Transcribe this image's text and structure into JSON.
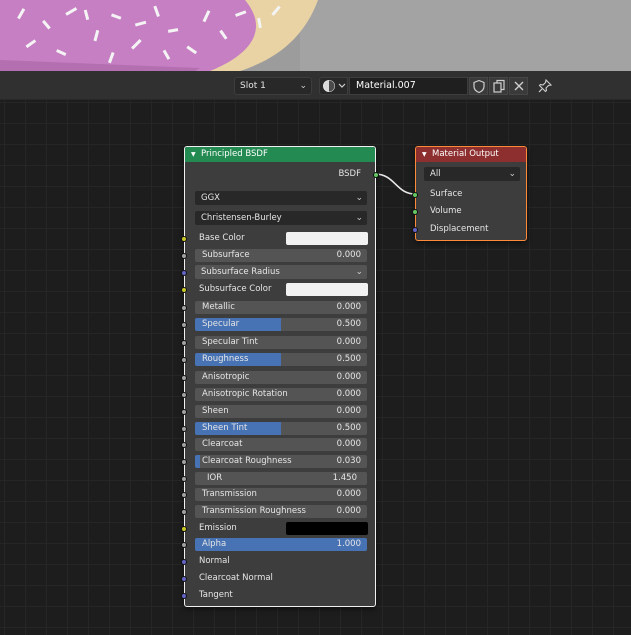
{
  "header": {
    "slot_label": "Slot 1",
    "material_name": "Material.007",
    "icons": [
      "material-sphere-icon",
      "shield-icon",
      "copy-icon",
      "close-icon",
      "pin-icon"
    ]
  },
  "bsdf_node": {
    "title": "Principled BSDF",
    "output_label": "BSDF",
    "distribution": "GGX",
    "subsurface_method": "Christensen-Burley",
    "inputs": [
      {
        "label": "Base Color",
        "kind": "color",
        "color": "#f2f2f2",
        "socket": "#c7c729"
      },
      {
        "label": "Subsurface",
        "kind": "value",
        "value": "0.000",
        "fill": 0,
        "socket": "#a1a1a1"
      },
      {
        "label": "Subsurface Radius",
        "kind": "vector-dropdown",
        "socket": "#6363c7"
      },
      {
        "label": "Subsurface Color",
        "kind": "color",
        "color": "#f2f2f2",
        "socket": "#c7c729"
      },
      {
        "label": "Metallic",
        "kind": "value",
        "value": "0.000",
        "fill": 0,
        "socket": "#a1a1a1"
      },
      {
        "label": "Specular",
        "kind": "value",
        "value": "0.500",
        "fill": 0.5,
        "socket": "#a1a1a1"
      },
      {
        "label": "Specular Tint",
        "kind": "value",
        "value": "0.000",
        "fill": 0,
        "socket": "#a1a1a1"
      },
      {
        "label": "Roughness",
        "kind": "value",
        "value": "0.500",
        "fill": 0.5,
        "socket": "#a1a1a1"
      },
      {
        "label": "Anisotropic",
        "kind": "value",
        "value": "0.000",
        "fill": 0,
        "socket": "#a1a1a1"
      },
      {
        "label": "Anisotropic Rotation",
        "kind": "value",
        "value": "0.000",
        "fill": 0,
        "socket": "#a1a1a1"
      },
      {
        "label": "Sheen",
        "kind": "value",
        "value": "0.000",
        "fill": 0,
        "socket": "#a1a1a1"
      },
      {
        "label": "Sheen Tint",
        "kind": "value",
        "value": "0.500",
        "fill": 0.5,
        "socket": "#a1a1a1"
      },
      {
        "label": "Clearcoat",
        "kind": "value",
        "value": "0.000",
        "fill": 0,
        "socket": "#a1a1a1"
      },
      {
        "label": "Clearcoat Roughness",
        "kind": "value",
        "value": "0.030",
        "fill": 0.03,
        "socket": "#a1a1a1"
      },
      {
        "label": "IOR",
        "kind": "value",
        "value": "1.450",
        "fill": 0,
        "socket": "#a1a1a1"
      },
      {
        "label": "Transmission",
        "kind": "value",
        "value": "0.000",
        "fill": 0,
        "socket": "#a1a1a1"
      },
      {
        "label": "Transmission Roughness",
        "kind": "value",
        "value": "0.000",
        "fill": 0,
        "socket": "#a1a1a1"
      },
      {
        "label": "Emission",
        "kind": "color",
        "color": "#000000",
        "socket": "#c7c729"
      },
      {
        "label": "Alpha",
        "kind": "value",
        "value": "1.000",
        "fill": 1,
        "socket": "#a1a1a1"
      },
      {
        "label": "Normal",
        "kind": "plain",
        "socket": "#6363c7"
      },
      {
        "label": "Clearcoat Normal",
        "kind": "plain",
        "socket": "#6363c7"
      },
      {
        "label": "Tangent",
        "kind": "plain",
        "socket": "#6363c7"
      }
    ]
  },
  "output_node": {
    "title": "Material Output",
    "target": "All",
    "inputs": [
      {
        "label": "Surface",
        "socket": "#63c763"
      },
      {
        "label": "Volume",
        "socket": "#63c763"
      },
      {
        "label": "Displacement",
        "socket": "#6363c7"
      }
    ]
  },
  "colors": {
    "bsdf_header": "#238a52",
    "output_header": "#8e2f2f",
    "slider_fill": "#4772b3",
    "donut_frosting": "#c77fc4"
  }
}
